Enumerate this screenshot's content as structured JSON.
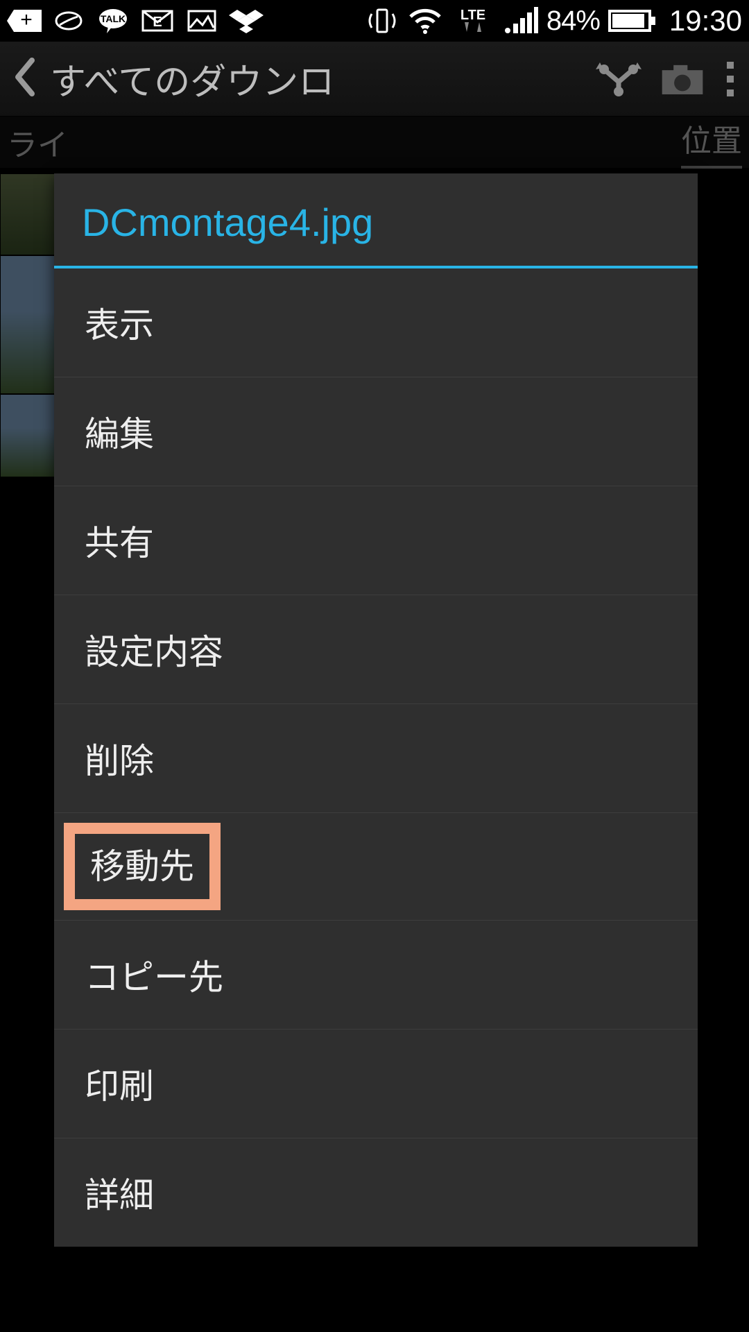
{
  "statusbar": {
    "lte": "LTE",
    "battery_pct": "84%",
    "time": "19:30"
  },
  "header": {
    "title": "すべてのダウンロ"
  },
  "tabs": {
    "left_partial": "ライ",
    "right_partial": "位置"
  },
  "dialog": {
    "title": "DCmontage4.jpg",
    "items": [
      "表示",
      "編集",
      "共有",
      "設定内容",
      "削除",
      "移動先",
      "コピー先",
      "印刷",
      "詳細"
    ],
    "highlighted_index": 5
  }
}
